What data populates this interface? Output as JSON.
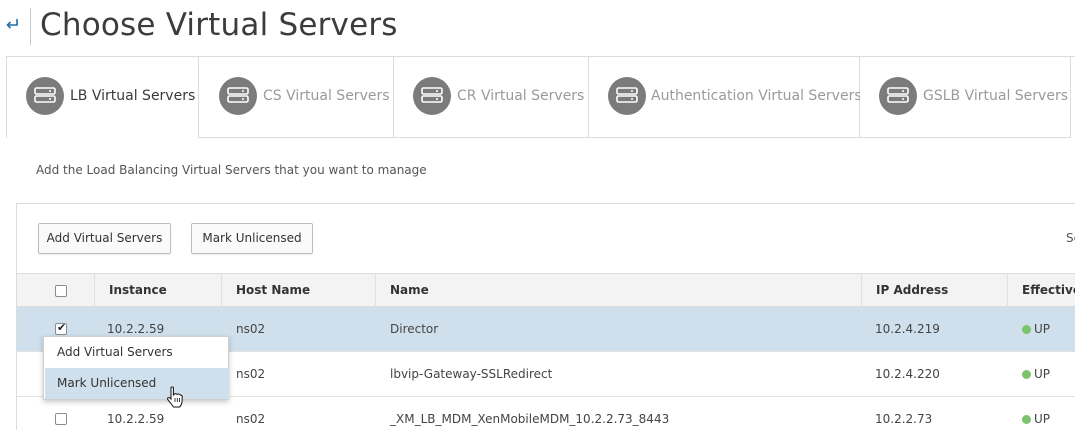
{
  "header": {
    "title": "Choose Virtual Servers",
    "back_icon": "back-arrow-icon"
  },
  "tabs": [
    {
      "label": "LB Virtual Servers",
      "icon": "server-icon",
      "active": true
    },
    {
      "label": "CS Virtual Servers",
      "icon": "server-icon",
      "active": false
    },
    {
      "label": "CR Virtual Servers",
      "icon": "server-icon",
      "active": false
    },
    {
      "label": "Authentication Virtual Servers",
      "icon": "server-icon",
      "active": false
    },
    {
      "label": "GSLB Virtual Servers",
      "icon": "server-icon",
      "active": false
    }
  ],
  "instruction": "Add the Load Balancing Virtual Servers that you want to manage",
  "toolbar": {
    "add_label": "Add Virtual Servers",
    "mark_label": "Mark Unlicensed",
    "search_hint": "Se"
  },
  "table": {
    "columns": [
      "Instance",
      "Host Name",
      "Name",
      "IP Address",
      "Effective"
    ],
    "rows": [
      {
        "instance": "10.2.2.59",
        "host": "ns02",
        "name": "Director",
        "ip": "10.2.4.219",
        "status": "UP",
        "checked": true
      },
      {
        "instance": "",
        "host": "ns02",
        "name": "lbvip-Gateway-SSLRedirect",
        "ip": "10.2.4.220",
        "status": "UP",
        "checked": false
      },
      {
        "instance": "10.2.2.59",
        "host": "ns02",
        "name": "_XM_LB_MDM_XenMobileMDM_10.2.2.73_8443",
        "ip": "10.2.2.73",
        "status": "UP",
        "checked": false
      }
    ]
  },
  "context_menu": {
    "items": [
      "Add Virtual Servers",
      "Mark Unlicensed"
    ],
    "hovered": "Mark Unlicensed"
  },
  "colors": {
    "selected_row": "#cfe0ec",
    "status_up": "#7cc36b",
    "tab_icon": "#7b7b7b",
    "link_blue": "#1f6fae"
  }
}
